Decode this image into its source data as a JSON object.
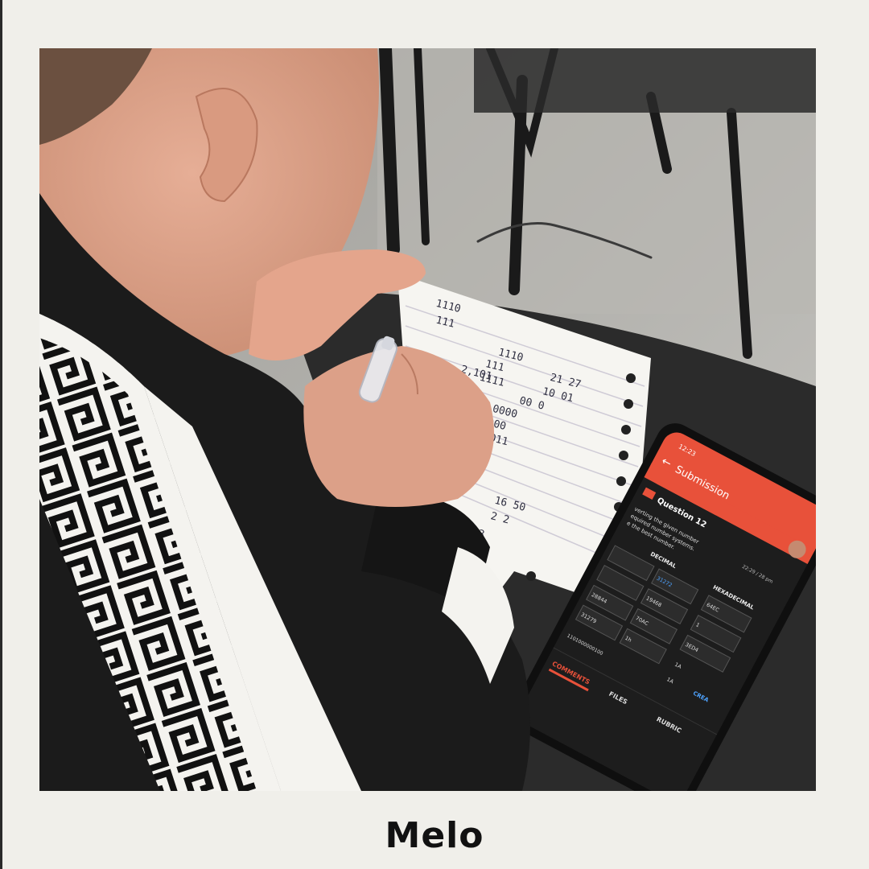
{
  "caption": "Melo",
  "photo": {
    "notebook_scribbles": [
      "1110",
      "111",
      "1110",
      "111",
      "1111",
      "2,101",
      "21 27",
      "10 01",
      "00 0",
      "0000",
      "0000",
      "011",
      "16 50",
      "2 2",
      "3"
    ],
    "phone_screen": {
      "status_time": "12:23",
      "app_title": "Submission",
      "question_label": "Question 12",
      "instruction_lines": [
        "verting the given number",
        "equired number systems.",
        "e the best number."
      ],
      "timestamp": "22:29 / 28 pm",
      "column_decimal": "DECIMAL",
      "column_hexadecimal": "HEXADECIMAL",
      "cells": [
        "31272",
        "64EC",
        "1",
        "19468",
        "3ED4",
        "1A",
        "28844",
        "70AC",
        "1h",
        "31279",
        "1A",
        "1101000000100"
      ],
      "link_text": "CREA",
      "tabs": [
        "COMMENTS",
        "FILES",
        "RUBRIC"
      ]
    },
    "colors": {
      "accent": "#e8513a",
      "screen_bg": "#1d1d1d",
      "jacket": "#1b1b1b",
      "stripe": "#f5f5f2"
    }
  }
}
